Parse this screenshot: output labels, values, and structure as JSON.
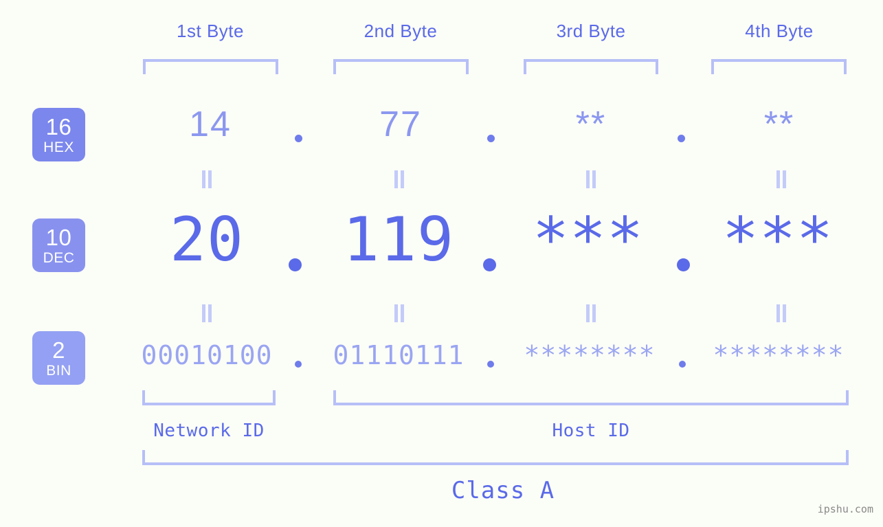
{
  "meta": {
    "background_color": "#fbfdf7",
    "accent_color": "#5a6ae8",
    "muted_accent_color": "#b6bff7"
  },
  "headers": {
    "bytes": [
      {
        "label": "1st Byte"
      },
      {
        "label": "2nd Byte"
      },
      {
        "label": "3rd Byte"
      },
      {
        "label": "4th Byte"
      }
    ]
  },
  "bases": [
    {
      "number": "16",
      "name": "HEX",
      "color": "#7b87ec"
    },
    {
      "number": "10",
      "name": "DEC",
      "color": "#8892ee"
    },
    {
      "number": "2",
      "name": "BIN",
      "color": "#93a0f3"
    }
  ],
  "rows": {
    "hex": {
      "base_number": "16",
      "base_name": "HEX",
      "values": [
        "14",
        "77",
        "**",
        "**"
      ],
      "separator": "."
    },
    "dec": {
      "base_number": "10",
      "base_name": "DEC",
      "values": [
        "20",
        "119",
        "***",
        "***"
      ],
      "separator": "."
    },
    "bin": {
      "base_number": "2",
      "base_name": "BIN",
      "values": [
        "00010100",
        "01110111",
        "********",
        "********"
      ],
      "separator": "."
    }
  },
  "connectors": {
    "symbol": "||",
    "meaning": "equals"
  },
  "footer": {
    "network_id_label": "Network ID",
    "host_id_label": "Host ID",
    "class_label": "Class A",
    "watermark": "ipshu.com"
  }
}
